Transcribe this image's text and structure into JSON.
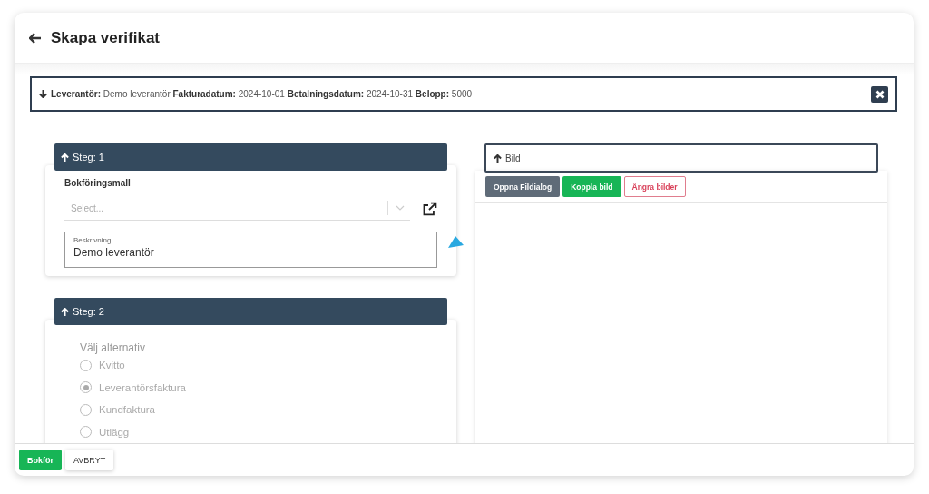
{
  "header": {
    "title": "Skapa verifikat"
  },
  "summary": {
    "parts": [
      {
        "label": "Leverantör:",
        "value": "Demo leverantör"
      },
      {
        "label": "Fakturadatum:",
        "value": "2024-10-01"
      },
      {
        "label": "Betalningsdatum:",
        "value": "2024-10-31"
      },
      {
        "label": "Belopp:",
        "value": "5000"
      }
    ]
  },
  "step1": {
    "title": "Steg: 1",
    "template_label": "Bokföringsmall",
    "template_select": {
      "placeholder": "Select..."
    },
    "description": {
      "label": "Beskrivning",
      "value": "Demo leverantör"
    }
  },
  "step2": {
    "title": "Steg: 2",
    "group_label": "Välj alternativ",
    "disabled": true,
    "options": [
      {
        "label": "Kvitto",
        "selected": false
      },
      {
        "label": "Leverantörsfaktura",
        "selected": true
      },
      {
        "label": "Kundfaktura",
        "selected": false
      },
      {
        "label": "Utlägg",
        "selected": false
      }
    ]
  },
  "image_panel": {
    "title": "Bild",
    "buttons": [
      {
        "label": "Öppna Fildialog",
        "kind": "secondary"
      },
      {
        "label": "Koppla bild",
        "kind": "success"
      },
      {
        "label": "Ångra bilder",
        "kind": "danger-outline"
      }
    ]
  },
  "footer": {
    "buttons": [
      {
        "label": "Bokför",
        "kind": "success"
      },
      {
        "label": "AVBRYT",
        "kind": "plain"
      }
    ]
  }
}
